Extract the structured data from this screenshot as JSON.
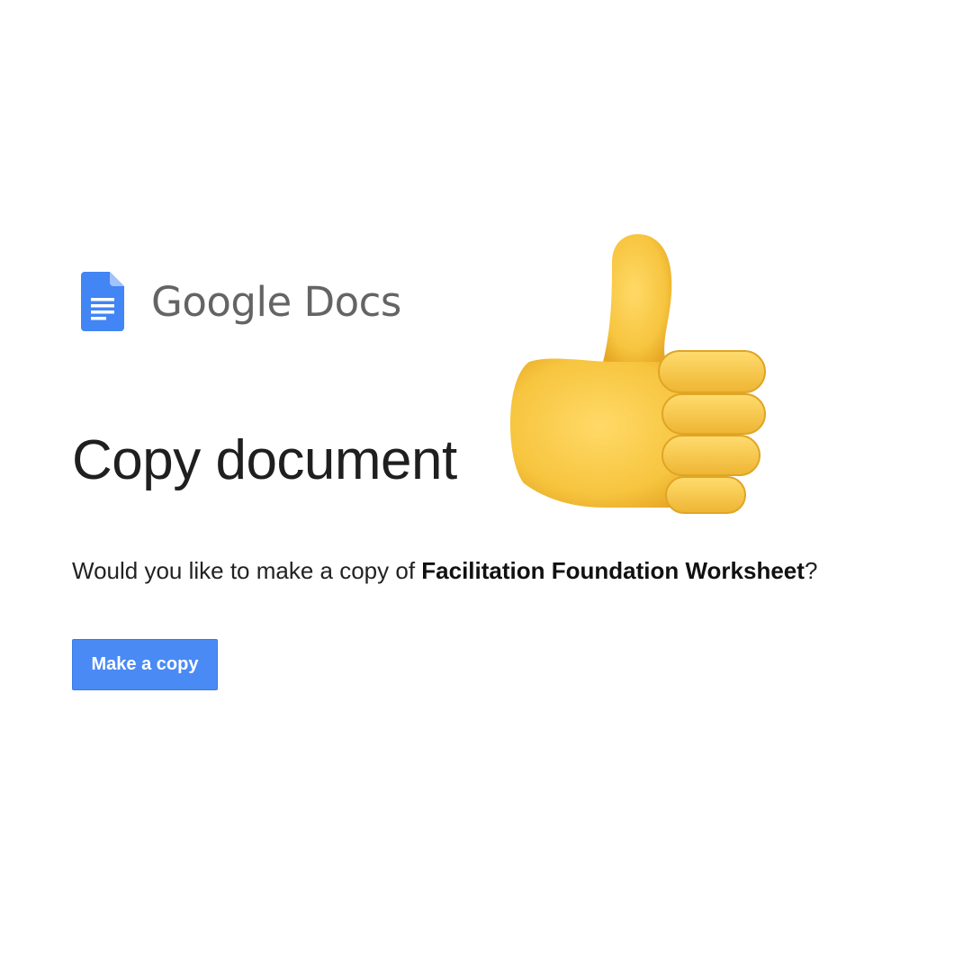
{
  "brand": {
    "name": "Google Docs",
    "icon": "google-docs-icon",
    "icon_color": "#4285f4"
  },
  "dialog": {
    "title": "Copy document",
    "prompt_prefix": "Would you like to make a copy of ",
    "document_name": "Facilitation Foundation Worksheet",
    "prompt_suffix": "?",
    "button_label": "Make a copy",
    "button_color": "#4a8af4"
  },
  "overlay": {
    "emoji": "thumbs-up-icon",
    "color": "#f7c94a"
  }
}
